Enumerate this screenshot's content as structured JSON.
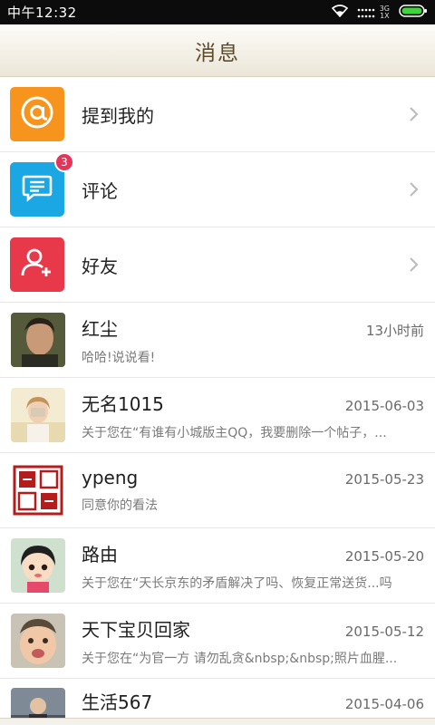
{
  "status_bar": {
    "time": "中午12:32",
    "network_top": "3G",
    "network_bottom": "1X"
  },
  "header": {
    "title": "消息"
  },
  "categories": [
    {
      "label": "提到我的",
      "icon": "at-icon",
      "color": "#f7941d",
      "badge": ""
    },
    {
      "label": "评论",
      "icon": "comment-icon",
      "color": "#1aa7e3",
      "badge": "3"
    },
    {
      "label": "好友",
      "icon": "add-friend-icon",
      "color": "#e8394a",
      "badge": ""
    }
  ],
  "messages": [
    {
      "name": "红尘",
      "date": "13小时前",
      "preview": "哈哈!说说看!"
    },
    {
      "name": "无名1015",
      "date": "2015-06-03",
      "preview": "关于您在“有谁有小城版主QQ，我要删除一个帖子，..."
    },
    {
      "name": "ypeng",
      "date": "2015-05-23",
      "preview": "同意你的看法"
    },
    {
      "name": "路由",
      "date": "2015-05-20",
      "preview": "关于您在“天长京东的矛盾解决了吗、恢复正常送货...吗"
    },
    {
      "name": "天下宝贝回家",
      "date": "2015-05-12",
      "preview": "关于您在“为官一方 请勿乱贪&nbsp;&nbsp;照片血腥..."
    },
    {
      "name": "生活567",
      "date": "2015-04-06",
      "preview": ""
    }
  ]
}
